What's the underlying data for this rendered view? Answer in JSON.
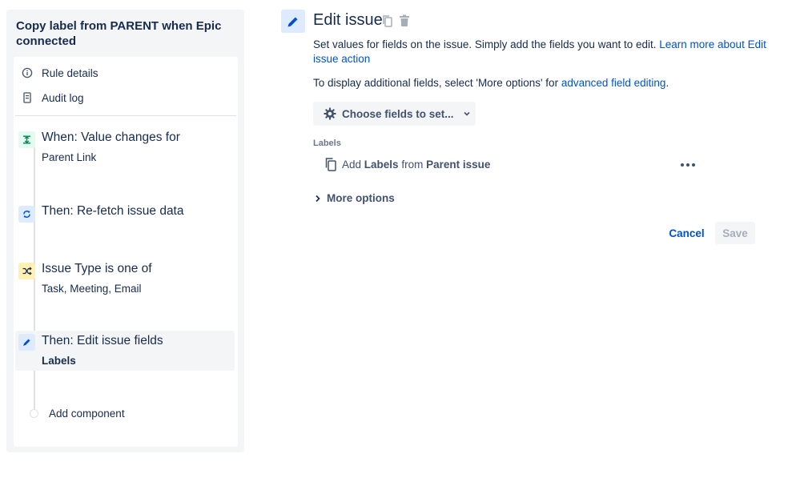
{
  "rule": {
    "title": "Copy label from PARENT when Epic connected"
  },
  "sidebar": {
    "rule_details": "Rule details",
    "audit_log": "Audit log",
    "components": [
      {
        "title": "When: Value changes for",
        "subtitle": "Parent Link",
        "icon": "trigger-icon",
        "color": "#00875a"
      },
      {
        "title": "Then: Re-fetch issue data",
        "subtitle": "",
        "icon": "refresh-icon",
        "color": "#0052cc"
      },
      {
        "title": "Issue Type is one of",
        "subtitle": "Task, Meeting, Email",
        "icon": "condition-icon",
        "color": "#ff8b00"
      },
      {
        "title": "Then: Edit issue fields",
        "subtitle": "Labels",
        "icon": "pencil-icon",
        "color": "#0052cc"
      }
    ],
    "add_component": "Add component"
  },
  "editor": {
    "title": "Edit issue",
    "description_text": "Set values for fields on the issue. Simply add the fields you want to edit. ",
    "description_link": "Learn more about Edit issue action",
    "hint_text": "To display additional fields, select 'More options' for ",
    "hint_link": "advanced field editing",
    "hint_end": ".",
    "choose_fields": "Choose fields to set...",
    "field_section_label": "Labels",
    "label_row": {
      "prefix": "Add",
      "field": "Labels",
      "middle": "from",
      "source": "Parent issue"
    },
    "more_options": "More options",
    "cancel": "Cancel",
    "save": "Save"
  },
  "colors": {
    "accent": "#0052cc",
    "text": "#172b4d",
    "subtle": "#42526e",
    "panel_bg": "#f4f5f7"
  }
}
